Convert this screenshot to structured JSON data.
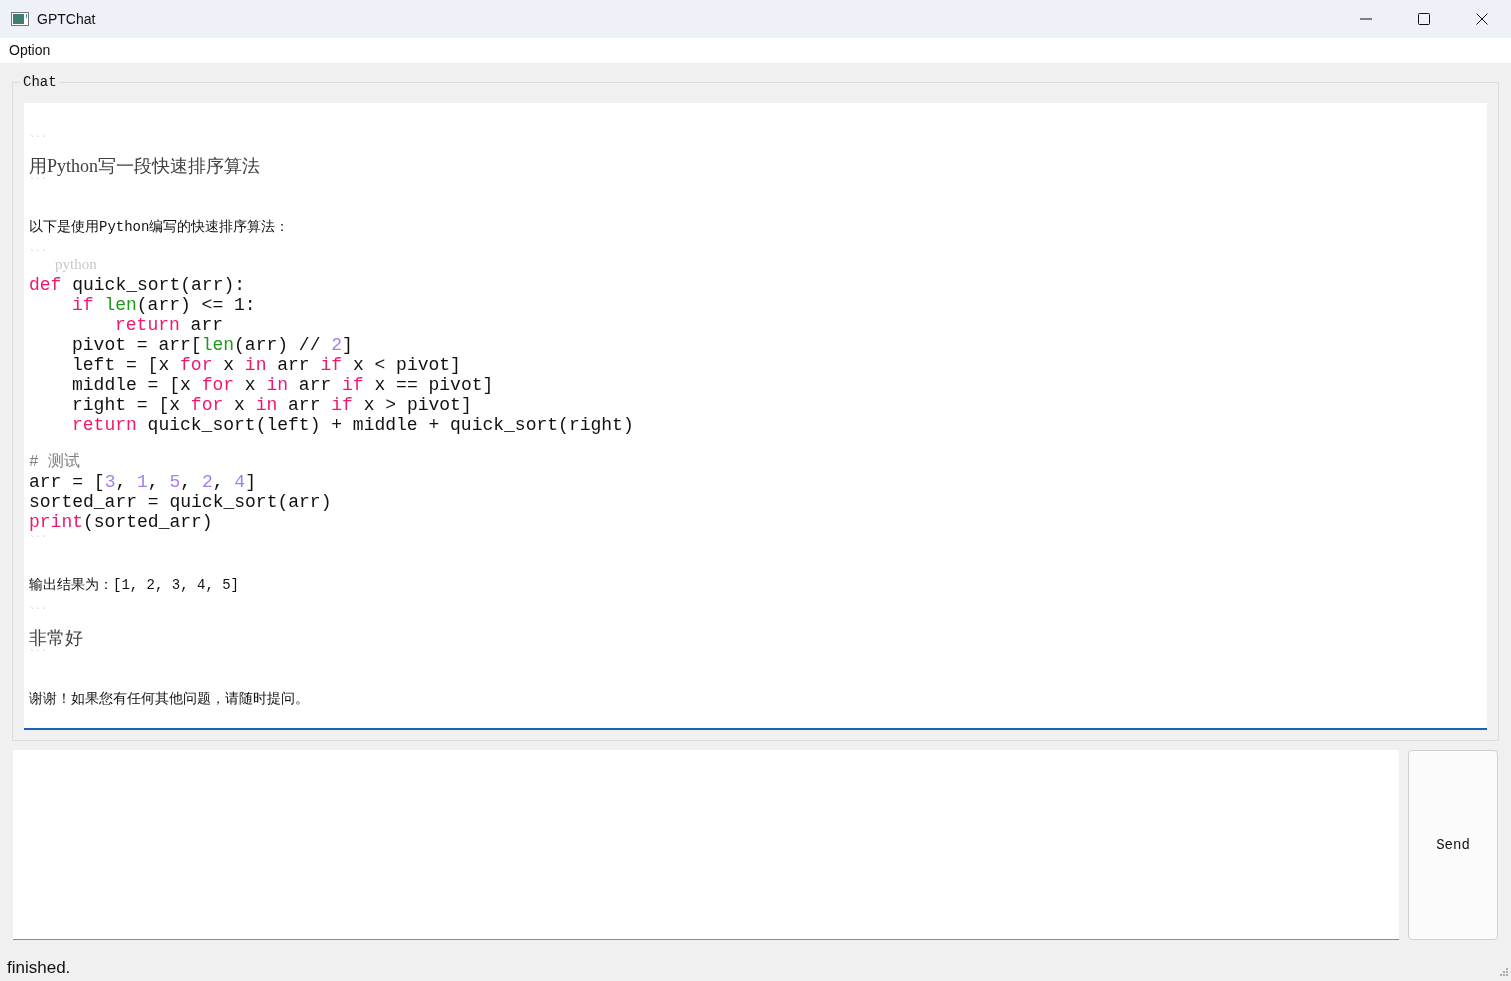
{
  "window": {
    "title": "GPTChat"
  },
  "menu": [
    "Option"
  ],
  "chat": {
    "title": "Chat",
    "blocks": [
      {
        "kind": "fence",
        "text": "```"
      },
      {
        "kind": "question",
        "text": "用Python写一段快速排序算法"
      },
      {
        "kind": "fence",
        "text": "```"
      },
      {
        "kind": "answer",
        "text": "以下是使用Python编写的快速排序算法："
      },
      {
        "kind": "fence",
        "text": "```"
      },
      {
        "kind": "lang",
        "text": "python"
      },
      {
        "kind": "code",
        "lines": [
          {
            "tokens": [
              {
                "text": "def",
                "kind": "keyword"
              },
              {
                "text": " quick_sort(arr):",
                "kind": "plain"
              }
            ],
            "children": [
              {
                "tokens": [
                  {
                    "text": "if ",
                    "kind": "keyword"
                  },
                  {
                    "text": "len",
                    "kind": "builtin"
                  },
                  {
                    "text": "(arr) <= 1:",
                    "kind": "plain"
                  }
                ],
                "children": [
                  {
                    "tokens": [
                      {
                        "text": "return",
                        "kind": "keyword"
                      },
                      {
                        "text": " arr",
                        "kind": "plain"
                      }
                    ]
                  }
                ]
              },
              {
                "tokens": [
                  {
                    "text": "pivot = arr[",
                    "kind": "plain"
                  },
                  {
                    "text": "len",
                    "kind": "builtin"
                  },
                  {
                    "text": "(arr) // ",
                    "kind": "plain"
                  },
                  {
                    "text": "2",
                    "kind": "number"
                  },
                  {
                    "text": "]",
                    "kind": "plain"
                  }
                ]
              },
              {
                "tokens": [
                  {
                    "text": "left = [x ",
                    "kind": "plain"
                  },
                  {
                    "text": "for",
                    "kind": "keyword"
                  },
                  {
                    "text": " x ",
                    "kind": "plain"
                  },
                  {
                    "text": "in",
                    "kind": "keyword"
                  },
                  {
                    "text": " arr ",
                    "kind": "plain"
                  },
                  {
                    "text": "if",
                    "kind": "keyword"
                  },
                  {
                    "text": " x < pivot]",
                    "kind": "plain"
                  }
                ]
              },
              {
                "tokens": [
                  {
                    "text": "middle = [x ",
                    "kind": "plain"
                  },
                  {
                    "text": "for",
                    "kind": "keyword"
                  },
                  {
                    "text": " x ",
                    "kind": "plain"
                  },
                  {
                    "text": "in",
                    "kind": "keyword"
                  },
                  {
                    "text": " arr ",
                    "kind": "plain"
                  },
                  {
                    "text": "if",
                    "kind": "keyword"
                  },
                  {
                    "text": " x == pivot]",
                    "kind": "plain"
                  }
                ]
              },
              {
                "tokens": [
                  {
                    "text": "right = [x ",
                    "kind": "plain"
                  },
                  {
                    "text": "for",
                    "kind": "keyword"
                  },
                  {
                    "text": " x ",
                    "kind": "plain"
                  },
                  {
                    "text": "in",
                    "kind": "keyword"
                  },
                  {
                    "text": " arr ",
                    "kind": "plain"
                  },
                  {
                    "text": "if",
                    "kind": "keyword"
                  },
                  {
                    "text": " x > pivot]",
                    "kind": "plain"
                  }
                ]
              },
              {
                "tokens": [
                  {
                    "text": "return",
                    "kind": "keyword"
                  },
                  {
                    "text": " quick_sort(left) + middle + quick_sort(right)",
                    "kind": "plain"
                  }
                ]
              }
            ]
          }
        ]
      },
      {
        "kind": "code",
        "lines": [
          {
            "tokens": [
              {
                "text": "# 测试",
                "kind": "comment"
              }
            ]
          },
          {
            "tokens": [
              {
                "text": "arr = [",
                "kind": "plain"
              },
              {
                "text": "3",
                "kind": "number"
              },
              {
                "text": ", ",
                "kind": "plain"
              },
              {
                "text": "1",
                "kind": "number"
              },
              {
                "text": ", ",
                "kind": "plain"
              },
              {
                "text": "5",
                "kind": "number"
              },
              {
                "text": ", ",
                "kind": "plain"
              },
              {
                "text": "2",
                "kind": "number"
              },
              {
                "text": ", ",
                "kind": "plain"
              },
              {
                "text": "4",
                "kind": "number"
              },
              {
                "text": "]",
                "kind": "plain"
              }
            ]
          },
          {
            "tokens": [
              {
                "text": "sorted_arr = quick_sort(arr)",
                "kind": "plain"
              }
            ]
          },
          {
            "tokens": [
              {
                "text": "print",
                "kind": "keyword"
              },
              {
                "text": "(sorted_arr)",
                "kind": "plain"
              }
            ]
          }
        ]
      },
      {
        "kind": "fence",
        "text": "```"
      },
      {
        "kind": "answer",
        "text": "输出结果为：[1, 2, 3, 4, 5]"
      },
      {
        "kind": "fence",
        "text": "```"
      },
      {
        "kind": "question",
        "text": "非常好"
      },
      {
        "kind": "fence",
        "text": "```"
      },
      {
        "kind": "answer",
        "text": "谢谢！如果您有任何其他问题，请随时提问。"
      }
    ]
  },
  "send_button": "Send",
  "status_bar": "finished."
}
